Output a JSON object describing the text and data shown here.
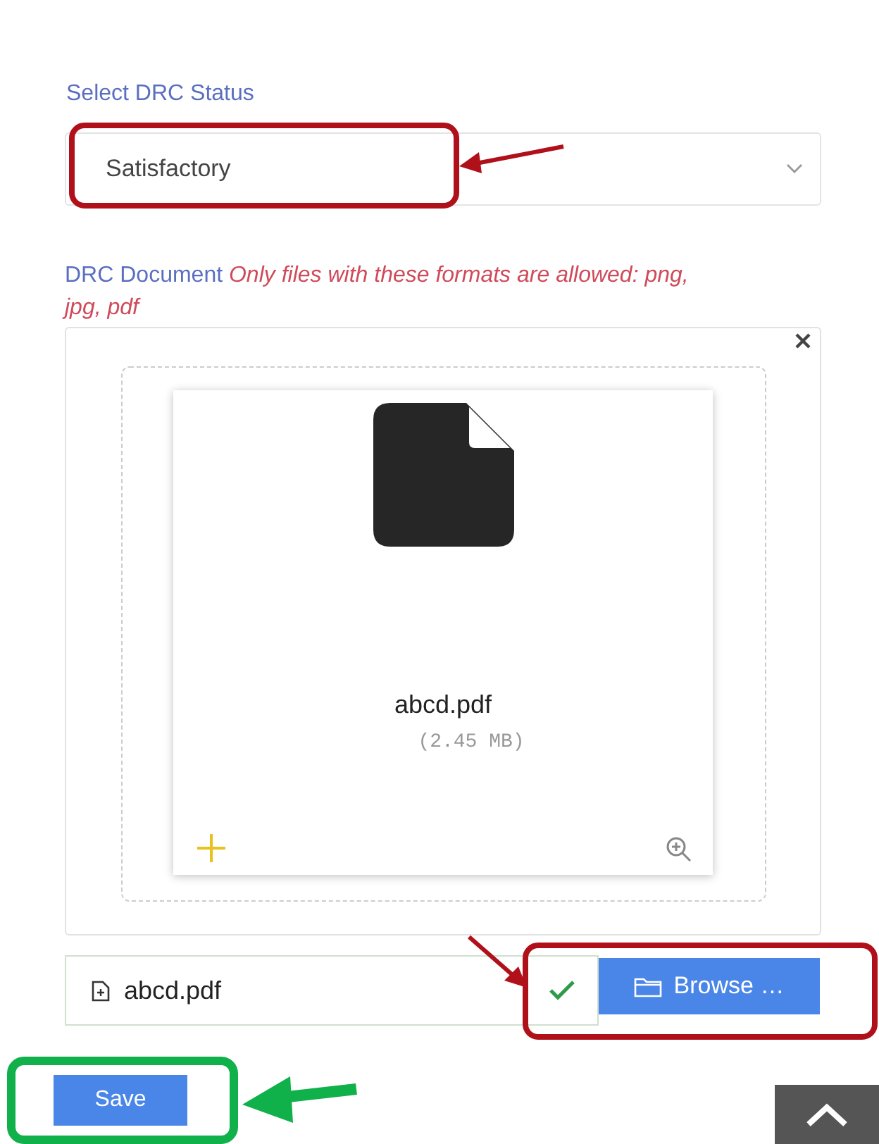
{
  "status_field": {
    "label": "Select DRC Status",
    "value": "Satisfactory"
  },
  "document": {
    "label": "DRC Document *Only files with these formats are allowed: png, jpg, pdf*",
    "preview": {
      "file_name": "abcd.pdf",
      "file_size": "(2.45 MB)"
    },
    "file_input": {
      "value": "abcd.pdf",
      "valid": true
    },
    "browse_button": "Browse …"
  },
  "save_button": "Save"
}
